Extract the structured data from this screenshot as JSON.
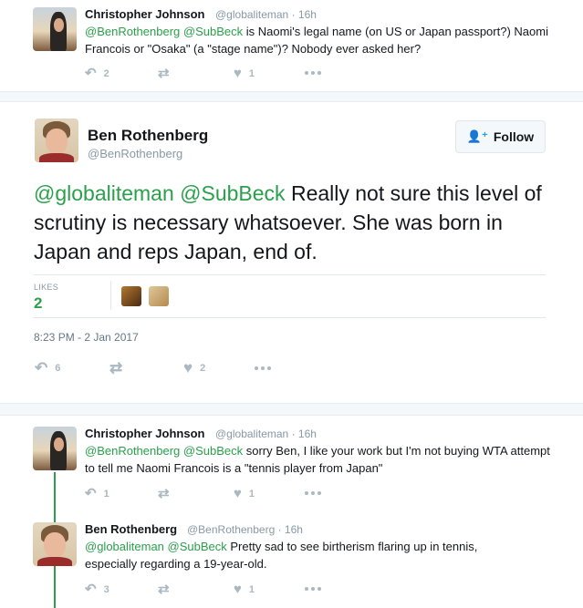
{
  "tweet_top": {
    "name": "Christopher Johnson",
    "handle": "@globaliteman",
    "time": "· 16h",
    "mentions": "@BenRothenberg @SubBeck",
    "text": " is Naomi's legal name (on US or Japan passport?) Naomi Francois or \"Osaka\" (a \"stage name\")? Nobody ever asked her?",
    "replies": "2",
    "retweets": "",
    "likes": "1"
  },
  "main_tweet": {
    "name": "Ben Rothenberg",
    "handle": "@BenRothenberg",
    "follow_label": "Follow",
    "mentions": "@globaliteman @SubBeck",
    "text": " Really not sure this level of scrutiny is necessary whatsoever. She was born in Japan and reps Japan, end of.",
    "likes_label": "LIKES",
    "likes_count": "2",
    "timestamp": "8:23 PM - 2 Jan 2017",
    "replies": "6",
    "retweets": "",
    "likes": "2"
  },
  "reply_1": {
    "name": "Christopher Johnson",
    "handle": "@globaliteman",
    "time": "· 16h",
    "mentions": "@BenRothenberg @SubBeck",
    "text": " sorry Ben, I like your work but I'm not buying WTA attempt to tell me Naomi Francois is a \"tennis player from Japan\"",
    "replies": "1",
    "retweets": "",
    "likes": "1"
  },
  "reply_2": {
    "name": "Ben Rothenberg",
    "handle": "@BenRothenberg",
    "time": "· 16h",
    "mentions": "@globaliteman @SubBeck",
    "text": " Pretty sad to see birtherism flaring up in tennis, especially regarding a 19-year-old.",
    "replies": "3",
    "retweets": "",
    "likes": "1"
  },
  "icons": {
    "reply": "reply-icon",
    "retweet": "retweet-icon",
    "like": "heart-icon",
    "more": "more-icon",
    "follow": "follow-person-icon"
  },
  "colors": {
    "accent_green": "#2aa04b",
    "muted": "#aab8c2",
    "follow_blue": "#1da1f2"
  }
}
